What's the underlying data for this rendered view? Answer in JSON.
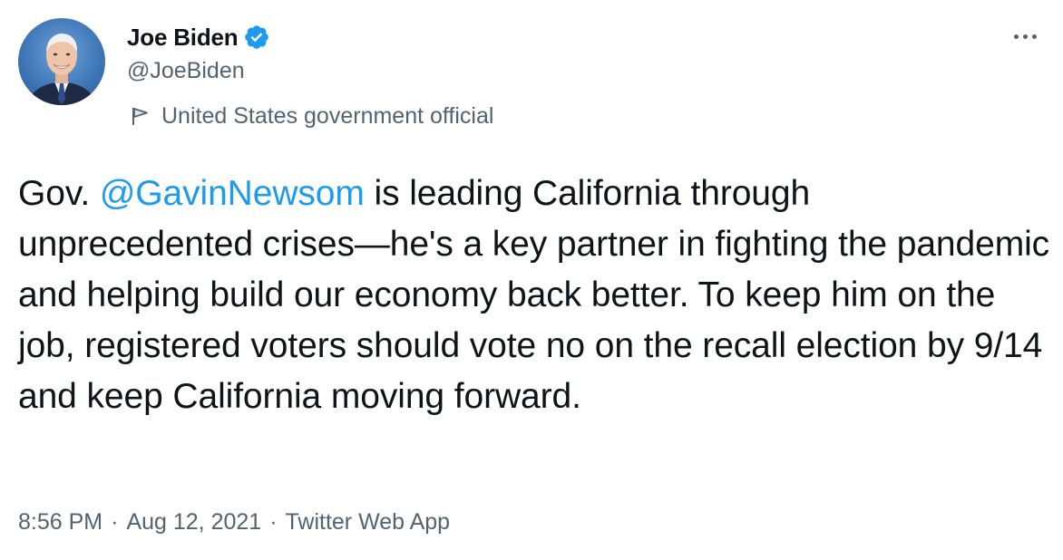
{
  "author": {
    "display_name": "Joe Biden",
    "handle": "@JoeBiden",
    "verified": true,
    "label": "United States government official",
    "label_icon": "flag-icon",
    "verified_icon": "verified-badge-icon"
  },
  "more_icon": "more-options-icon",
  "tweet": {
    "text_before": "Gov. ",
    "mention": "@GavinNewsom",
    "text_after": " is leading California through unprecedented crises—he's a key partner in fighting the pandemic and helping build our economy back better. To keep him on the job, registered voters should vote no on the recall election by 9/14 and keep California moving forward."
  },
  "meta": {
    "time": "8:56 PM",
    "separator": "·",
    "date": "Aug 12, 2021",
    "source": "Twitter Web App"
  },
  "colors": {
    "text": "#0f1419",
    "secondary": "#536471",
    "link": "#1d9bf0",
    "verified": "#1d9bf0"
  }
}
